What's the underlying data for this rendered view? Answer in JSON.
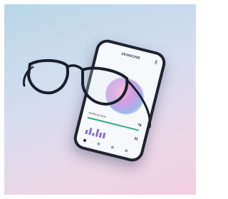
{
  "app": {
    "brand": "ZENNONE"
  },
  "phone": {
    "metric_label": "Nutritional Score",
    "metric_value": "78",
    "secondary_value": "32"
  },
  "chart_levels": [
    0.5,
    0.8,
    0.35,
    0.9,
    0.6,
    0.7
  ],
  "icons": [
    "menu-icon",
    "home-tab-icon",
    "stats-tab-icon",
    "heart-tab-icon",
    "profile-tab-icon"
  ]
}
